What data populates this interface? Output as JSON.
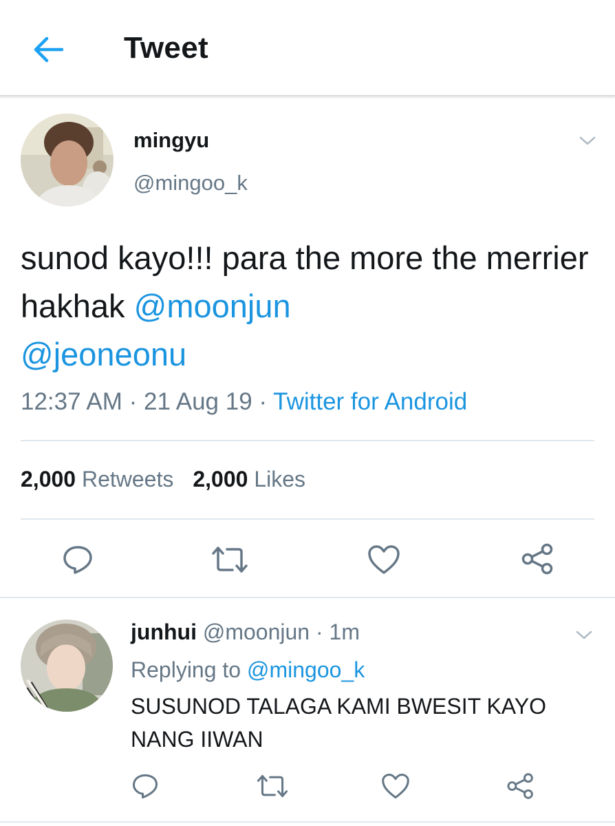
{
  "header": {
    "title": "Tweet",
    "back_icon": "arrow-left-icon",
    "accent_color": "#1da1f2"
  },
  "tweet": {
    "author_name": "mingyu",
    "author_handle": "@mingoo_k",
    "text_before": "sunod kayo!!! para the more the merrier hakhak ",
    "mention_1": "@moonjun",
    "mention_2": "@jeoneonu",
    "time": "12:37 AM",
    "date": "21 Aug 19",
    "separator": " · ",
    "source": "Twitter for Android",
    "retweet_count": "2,000",
    "retweet_label": "Retweets",
    "like_count": "2,000",
    "like_label": "Likes",
    "actions": [
      "reply-icon",
      "retweet-icon",
      "like-icon",
      "share-icon"
    ]
  },
  "reply": {
    "author_name": "junhui",
    "author_handle": "@moonjun",
    "separator": " · ",
    "time": "1m",
    "replying_to_label": "Replying to",
    "replying_to_handle": "@mingoo_k",
    "text": "SUSUNOD TALAGA KAMI BWESIT KAYO NANG IIWAN",
    "actions": [
      "reply-icon",
      "retweet-icon",
      "like-icon",
      "share-icon"
    ]
  }
}
